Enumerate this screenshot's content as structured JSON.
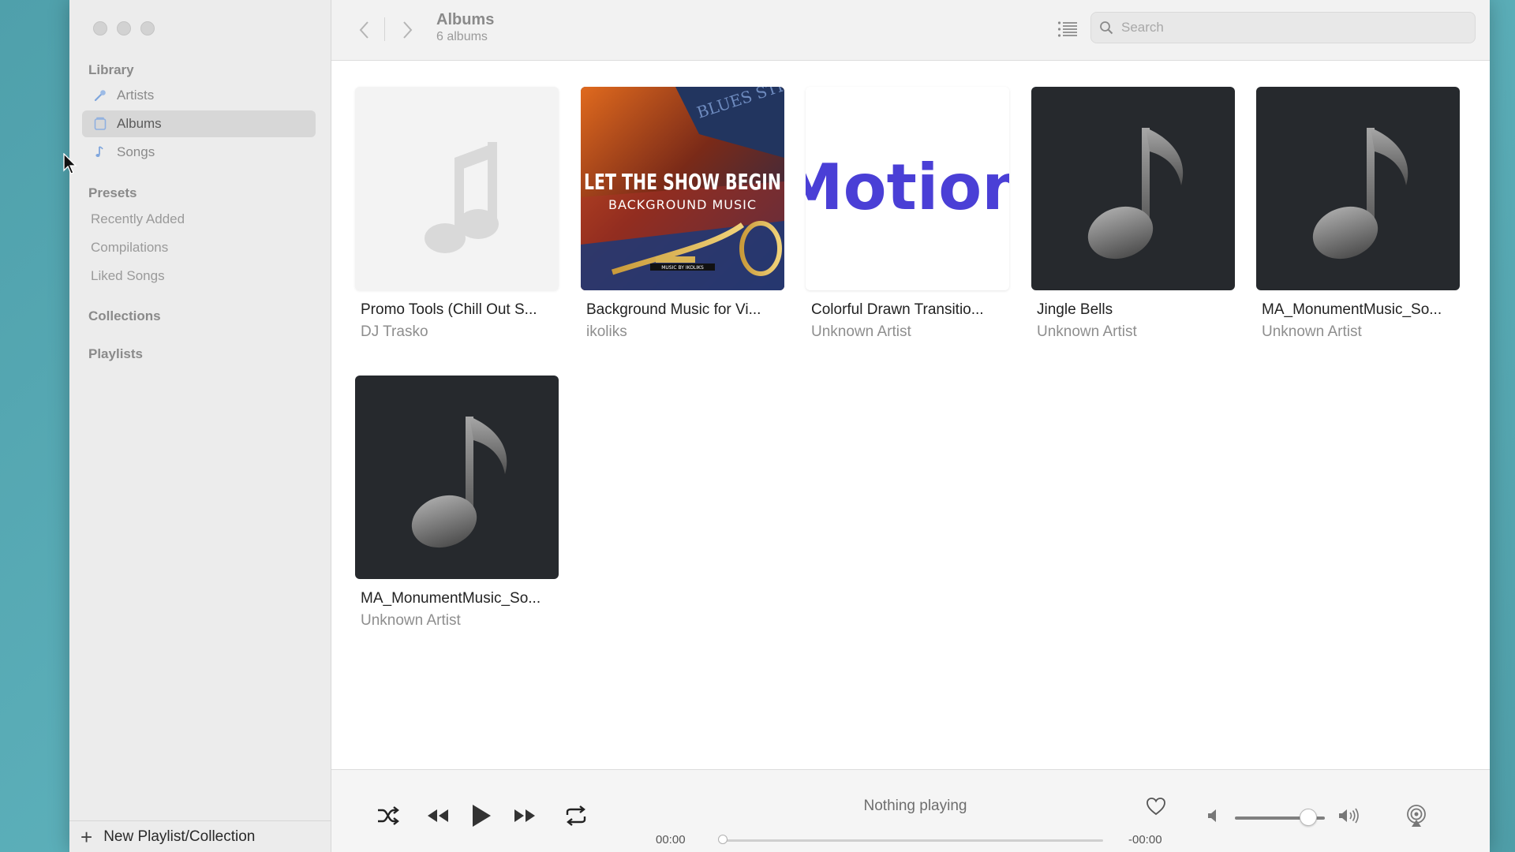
{
  "window": {
    "traffic_lights": [
      "close",
      "minimize",
      "zoom"
    ]
  },
  "sidebar": {
    "library_heading": "Library",
    "items": [
      {
        "label": "Artists",
        "icon": "artist-icon",
        "active": false
      },
      {
        "label": "Albums",
        "icon": "album-icon",
        "active": true
      },
      {
        "label": "Songs",
        "icon": "note-icon",
        "active": false
      }
    ],
    "presets_heading": "Presets",
    "presets": [
      "Recently Added",
      "Compilations",
      "Liked Songs"
    ],
    "collections_heading": "Collections",
    "playlists_heading": "Playlists",
    "new_label": "New Playlist/Collection"
  },
  "topbar": {
    "title": "Albums",
    "subtitle": "6 albums",
    "search_placeholder": "Search"
  },
  "albums": [
    {
      "title": "Promo Tools (Chill Out S...",
      "artist": "DJ Trasko",
      "art": "placeholder"
    },
    {
      "title": "Background Music for Vi...",
      "artist": "ikoliks",
      "art": "cover",
      "cover_text": [
        "LET THE SHOW BEGIN",
        "BACKGROUND MUSIC",
        "BLUES STREET",
        "MUSIC BY IKOLIKS"
      ]
    },
    {
      "title": "Colorful Drawn Transitio...",
      "artist": "Unknown Artist",
      "art": "motion",
      "cover_text": "Motion"
    },
    {
      "title": "Jingle Bells",
      "artist": "Unknown Artist",
      "art": "dark"
    },
    {
      "title": "MA_MonumentMusic_So...",
      "artist": "Unknown Artist",
      "art": "dark"
    },
    {
      "title": "MA_MonumentMusic_So...",
      "artist": "Unknown Artist",
      "art": "dark"
    }
  ],
  "player": {
    "now_playing": "Nothing playing",
    "elapsed": "00:00",
    "remaining": "-00:00",
    "progress": 0,
    "volume": 0.82
  },
  "colors": {
    "accent": "#5b8dd9",
    "motion_text": "#4a3fd6",
    "desktop": "#5aaab4"
  }
}
